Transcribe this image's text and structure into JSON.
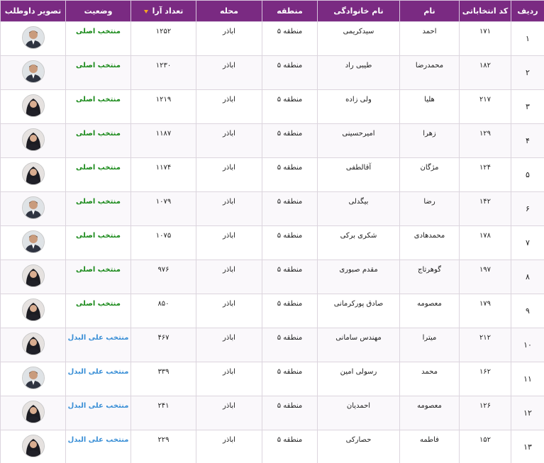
{
  "headers": {
    "row": "ردیف",
    "code": "کد انتخاباتی",
    "first_name": "نام",
    "last_name": "نام خانوادگی",
    "region": "منطقه",
    "district": "محله",
    "votes": "تعداد آرا",
    "status": "وضعیت",
    "photo": "تصویر داوطلب"
  },
  "rows": [
    {
      "no": "۱",
      "code": "۱۷۱",
      "first": "احمد",
      "last": "سیدکریمی",
      "region": "منطقه ۵",
      "district": "اباذر",
      "votes": "۱۲۵۲",
      "status": "منتخب اصلی",
      "kind": "main",
      "photo_icon": "man-portrait"
    },
    {
      "no": "۲",
      "code": "۱۸۲",
      "first": "محمدرضا",
      "last": "طیبی راد",
      "region": "منطقه ۵",
      "district": "اباذر",
      "votes": "۱۲۳۰",
      "status": "منتخب اصلی",
      "kind": "main",
      "photo_icon": "man-portrait"
    },
    {
      "no": "۳",
      "code": "۲۱۷",
      "first": "هلیا",
      "last": "ولی زاده",
      "region": "منطقه ۵",
      "district": "اباذر",
      "votes": "۱۲۱۹",
      "status": "منتخب اصلی",
      "kind": "main",
      "photo_icon": "woman-portrait"
    },
    {
      "no": "۴",
      "code": "۱۲۹",
      "first": "زهرا",
      "last": "امیرحسینی",
      "region": "منطقه ۵",
      "district": "اباذر",
      "votes": "۱۱۸۷",
      "status": "منتخب اصلی",
      "kind": "main",
      "photo_icon": "woman-portrait"
    },
    {
      "no": "۵",
      "code": "۱۲۴",
      "first": "مژگان",
      "last": "آقالطفی",
      "region": "منطقه ۵",
      "district": "اباذر",
      "votes": "۱۱۷۴",
      "status": "منتخب اصلی",
      "kind": "main",
      "photo_icon": "woman-portrait"
    },
    {
      "no": "۶",
      "code": "۱۴۲",
      "first": "رضا",
      "last": "بیگدلی",
      "region": "منطقه ۵",
      "district": "اباذر",
      "votes": "۱۰۷۹",
      "status": "منتخب اصلی",
      "kind": "main",
      "photo_icon": "man-portrait"
    },
    {
      "no": "۷",
      "code": "۱۷۸",
      "first": "محمدهادی",
      "last": "شکری برکی",
      "region": "منطقه ۵",
      "district": "اباذر",
      "votes": "۱۰۷۵",
      "status": "منتخب اصلی",
      "kind": "main",
      "photo_icon": "man-portrait"
    },
    {
      "no": "۸",
      "code": "۱۹۷",
      "first": "گوهرتاج",
      "last": "مقدم صبوری",
      "region": "منطقه ۵",
      "district": "اباذر",
      "votes": "۹۷۶",
      "status": "منتخب اصلی",
      "kind": "main",
      "photo_icon": "woman-portrait"
    },
    {
      "no": "۹",
      "code": "۱۷۹",
      "first": "معصومه",
      "last": "صادق پورکرمانی",
      "region": "منطقه ۵",
      "district": "اباذر",
      "votes": "۸۵۰",
      "status": "منتخب اصلی",
      "kind": "main",
      "photo_icon": "woman-portrait"
    },
    {
      "no": "۱۰",
      "code": "۲۱۲",
      "first": "میترا",
      "last": "مهندس سامانی",
      "region": "منطقه ۵",
      "district": "اباذر",
      "votes": "۴۶۷",
      "status": "منتخب علی البدل",
      "kind": "alt",
      "photo_icon": "woman-portrait"
    },
    {
      "no": "۱۱",
      "code": "۱۶۲",
      "first": "محمد",
      "last": "رسولی امین",
      "region": "منطقه ۵",
      "district": "اباذر",
      "votes": "۳۳۹",
      "status": "منتخب علی البدل",
      "kind": "alt",
      "photo_icon": "man-portrait"
    },
    {
      "no": "۱۲",
      "code": "۱۲۶",
      "first": "معصومه",
      "last": "احمدیان",
      "region": "منطقه ۵",
      "district": "اباذر",
      "votes": "۲۴۱",
      "status": "منتخب علی البدل",
      "kind": "alt",
      "photo_icon": "woman-portrait"
    },
    {
      "no": "۱۳",
      "code": "۱۵۲",
      "first": "فاطمه",
      "last": "حصارکی",
      "region": "منطقه ۵",
      "district": "اباذر",
      "votes": "۲۲۹",
      "status": "منتخب علی البدل",
      "kind": "alt",
      "photo_icon": "woman-portrait"
    }
  ],
  "colors": {
    "header_bg": "#7a2a82",
    "status_main": "#1a8a1a",
    "status_alt": "#3a8fd6",
    "sort_arrow": "#f5a623"
  }
}
